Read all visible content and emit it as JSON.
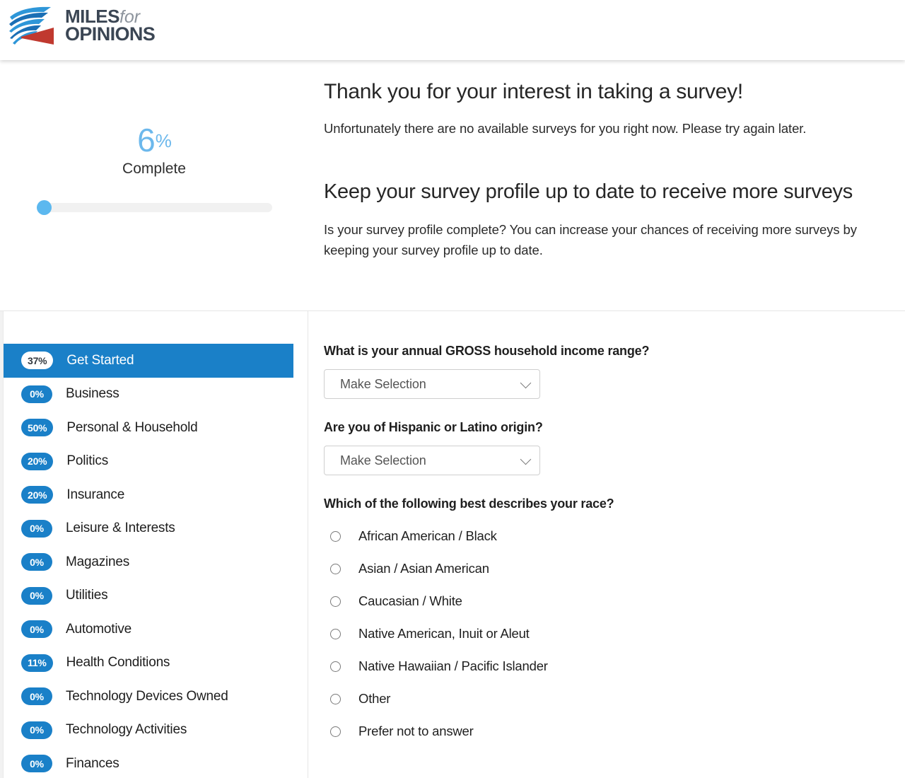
{
  "header": {
    "logo": {
      "line1": "MILES",
      "italic_word": "for",
      "line2": "OPINIONS",
      "mark_name": "miles-for-opinions-logo",
      "blue": "#1b6fb5",
      "light_blue": "#2e96d8",
      "red": "#c0392f",
      "text_color": "#3b4654"
    }
  },
  "progress": {
    "percent_number": "6",
    "percent_sign": "%",
    "complete_label": "Complete",
    "value": 6,
    "accent_color": "#6cb8ec",
    "track_color": "#f1f1f1"
  },
  "intro": {
    "title": "Thank you for your interest in taking a survey!",
    "subtitle": "Unfortunately there are no available surveys for you right now. Please try again later.",
    "title2": "Keep your survey profile up to date to receive more surveys",
    "body": "Is your survey profile complete? You can increase your chances of receiving more surveys by keeping your survey profile up to date."
  },
  "sidebar": {
    "active_color": "#1a80c8",
    "items": [
      {
        "badge": "37%",
        "label": "Get Started",
        "active": true
      },
      {
        "badge": "0%",
        "label": "Business",
        "active": false
      },
      {
        "badge": "50%",
        "label": "Personal & Household",
        "active": false
      },
      {
        "badge": "20%",
        "label": "Politics",
        "active": false
      },
      {
        "badge": "20%",
        "label": "Insurance",
        "active": false
      },
      {
        "badge": "0%",
        "label": "Leisure & Interests",
        "active": false
      },
      {
        "badge": "0%",
        "label": "Magazines",
        "active": false
      },
      {
        "badge": "0%",
        "label": "Utilities",
        "active": false
      },
      {
        "badge": "0%",
        "label": "Automotive",
        "active": false
      },
      {
        "badge": "11%",
        "label": "Health Conditions",
        "active": false
      },
      {
        "badge": "0%",
        "label": "Technology Devices Owned",
        "active": false
      },
      {
        "badge": "0%",
        "label": "Technology Activities",
        "active": false
      },
      {
        "badge": "0%",
        "label": "Finances",
        "active": false
      }
    ]
  },
  "form": {
    "questions": [
      {
        "type": "select",
        "label": "What is your annual GROSS household income range?",
        "value": "Make Selection"
      },
      {
        "type": "select",
        "label": "Are you of Hispanic or Latino origin?",
        "value": "Make Selection"
      },
      {
        "type": "radio",
        "label": "Which of the following best describes your race?",
        "options": [
          "African American / Black",
          "Asian / Asian American",
          "Caucasian / White",
          "Native American, Inuit or Aleut",
          "Native Hawaiian / Pacific Islander",
          "Other",
          "Prefer not to answer"
        ],
        "selected": null
      }
    ]
  }
}
